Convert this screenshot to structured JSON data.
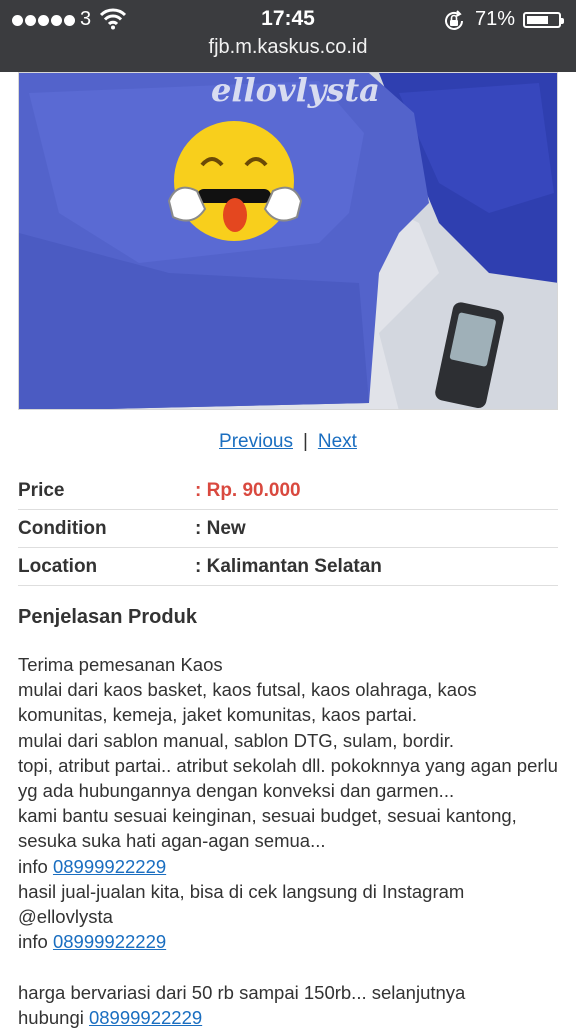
{
  "status_bar": {
    "carrier": "3",
    "time": "17:45",
    "battery_percent": "71%",
    "battery_level": 0.71,
    "url": "fjb.m.kaskus.co.id"
  },
  "photo": {
    "watermark": "ellovlysta",
    "alt": "product photo"
  },
  "pager": {
    "previous": "Previous",
    "separator": "|",
    "next": "Next"
  },
  "specs": [
    {
      "label": "Price",
      "value": ": Rp. 90.000",
      "highlight": true
    },
    {
      "label": "Condition",
      "value": ": New"
    },
    {
      "label": "Location",
      "value": ": Kalimantan Selatan"
    }
  ],
  "description": {
    "title": "Penjelasan Produk",
    "line_1": "Terima pemesanan Kaos",
    "line_2": "mulai dari kaos basket, kaos futsal, kaos olahraga, kaos komunitas, kemeja, jaket komunitas, kaos partai.",
    "line_3": "mulai dari sablon manual, sablon DTG, sulam, bordir.",
    "line_4": "topi, atribut partai.. atribut sekolah dll. pokoknnya yang agan perlu yg ada hubungannya dengan konveksi dan garmen...",
    "line_5": "kami bantu sesuai keinginan, sesuai budget, sesuai kantong, sesuka suka hati agan-agan semua...",
    "info_label": "info",
    "phone": "08999922229",
    "line_6": "hasil jual-jualan kita, bisa di cek langsung di Instagram @ellovlysta",
    "line_7": "harga bervariasi dari 50 rb sampai 150rb... selanjutnya",
    "contact_label": "hubungi"
  },
  "colors": {
    "status_bar_bg": "#3b3c3f",
    "price": "#d9493f",
    "link": "#1a6ec0",
    "shirt": "#5262c9"
  }
}
